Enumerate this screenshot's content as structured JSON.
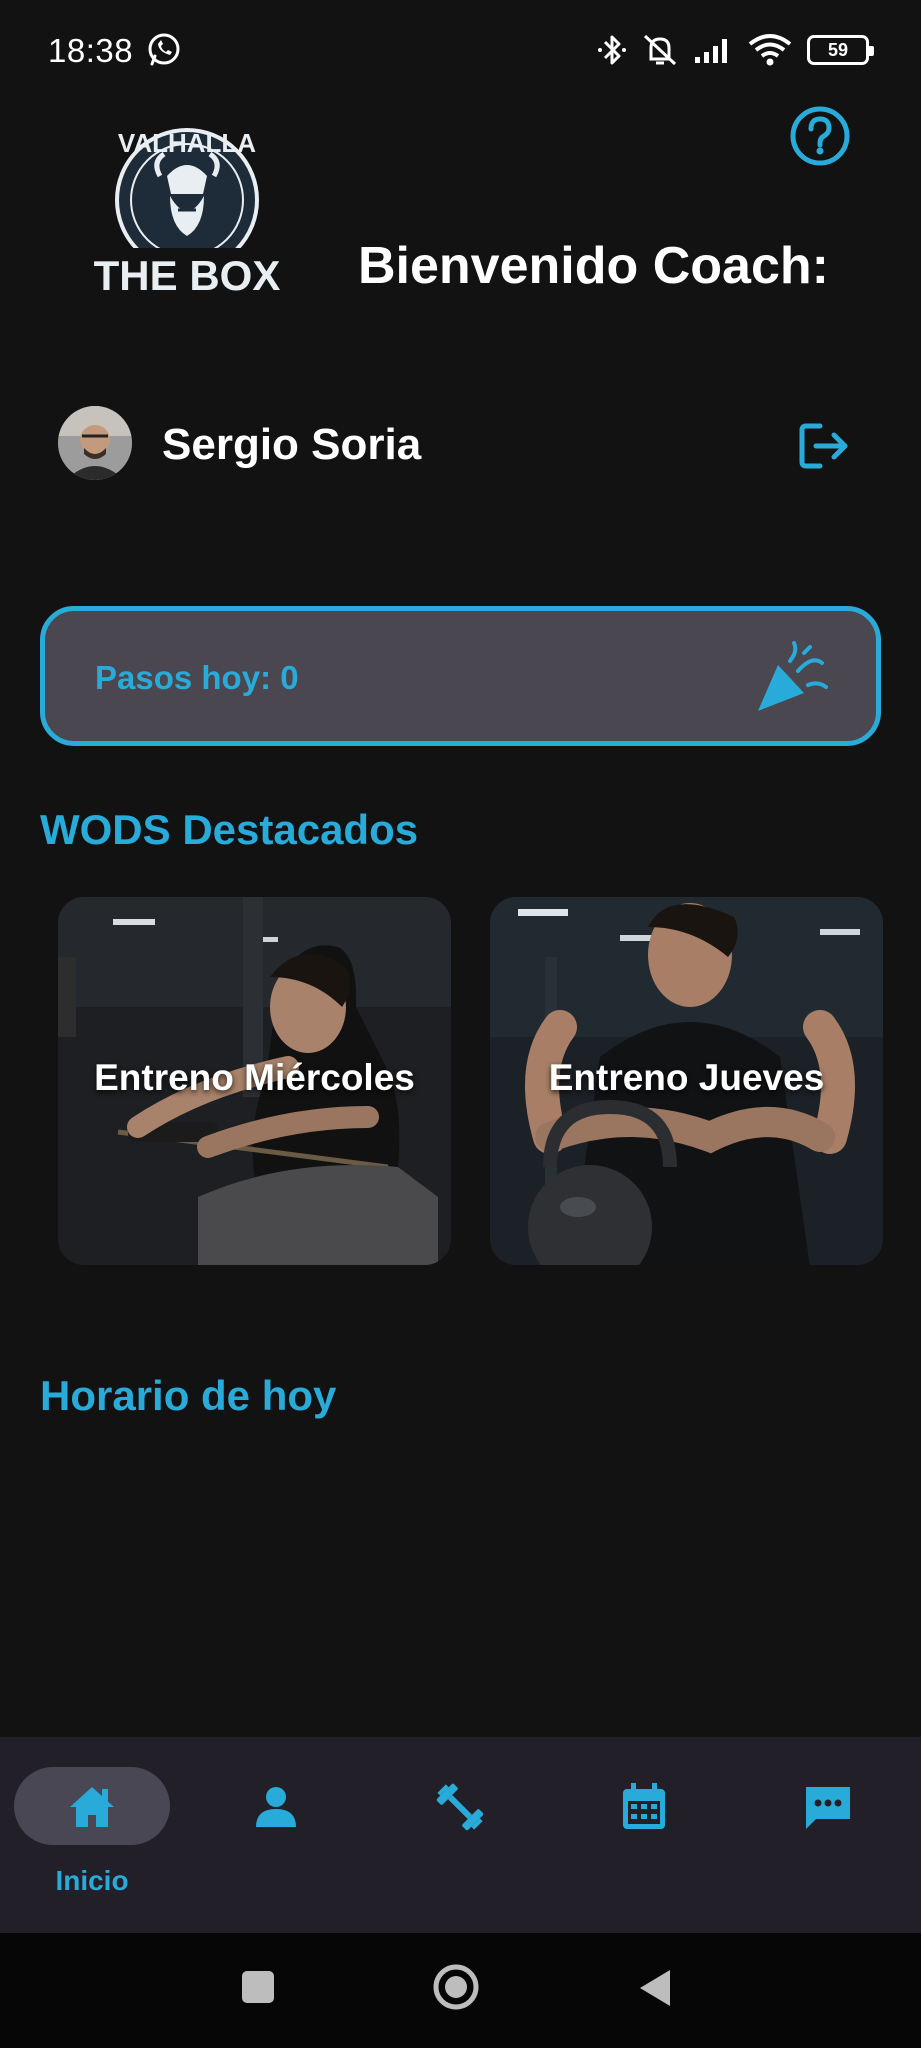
{
  "status_bar": {
    "time": "18:38",
    "battery": "59"
  },
  "header": {
    "logo_text_top": "VALHALLA",
    "logo_text_bottom": "THE BOX",
    "welcome": "Bienvenido Coach:"
  },
  "user": {
    "name": "Sergio Soria"
  },
  "steps": {
    "label": "Pasos hoy: 0"
  },
  "wods": {
    "title": "WODS Destacados",
    "items": [
      {
        "label": "Entreno Miércoles"
      },
      {
        "label": "Entreno Jueves"
      }
    ]
  },
  "schedule": {
    "title": "Horario de hoy"
  },
  "bottom_nav": {
    "items": [
      {
        "icon": "home-icon",
        "label": "Inicio",
        "active": true
      },
      {
        "icon": "person-icon",
        "label": "",
        "active": false
      },
      {
        "icon": "dumbbell-icon",
        "label": "",
        "active": false
      },
      {
        "icon": "calendar-icon",
        "label": "",
        "active": false
      },
      {
        "icon": "chat-icon",
        "label": "",
        "active": false
      }
    ]
  },
  "colors": {
    "accent": "#29abd9",
    "background": "#121212",
    "card": "#4a4750",
    "nav_bg": "#221f29"
  }
}
